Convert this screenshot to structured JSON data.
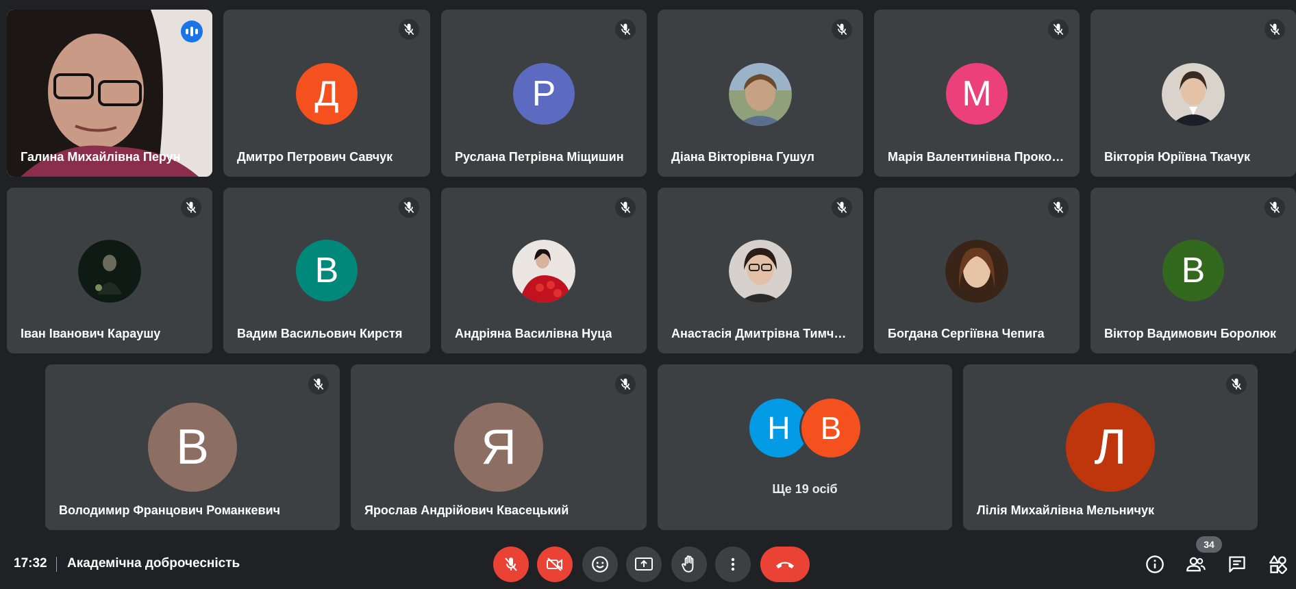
{
  "time": "17:32",
  "meeting_title": "Академічна доброчесність",
  "participant_count": "34",
  "participants": [
    {
      "name": "Галина Михайлівна Перун"
    },
    {
      "name": "Дмитро Петрович Савчук",
      "initial": "Д",
      "color": "#f4511e"
    },
    {
      "name": "Руслана Петрівна Міщишин",
      "initial": "Р",
      "color": "#5c6bc0"
    },
    {
      "name": "Діана Вікторівна Гушул"
    },
    {
      "name": "Марія Валентинівна Прокоп...",
      "initial": "М",
      "color": "#ec407a"
    },
    {
      "name": "Вікторія Юріївна Ткачук"
    },
    {
      "name": "Іван Іванович Караушу"
    },
    {
      "name": "Вадим Васильович Кирстя",
      "initial": "В",
      "color": "#00897b"
    },
    {
      "name": "Андріяна Василівна Нуца"
    },
    {
      "name": "Анастасія Дмитрівна Тимчи..."
    },
    {
      "name": "Богдана Сергіївна Чепига"
    },
    {
      "name": "Віктор Вадимович Боролюк",
      "initial": "В",
      "color": "#33691e"
    },
    {
      "name": "Володимир Францович Романкевич",
      "initial": "В",
      "color": "#8d6e63"
    },
    {
      "name": "Ярослав Андрійович Квасецький",
      "initial": "Я",
      "color": "#8d6e63"
    },
    {
      "name": "Лілія Михайлівна Мельничук",
      "initial": "Л",
      "color": "#bf360c"
    }
  ],
  "others_tile": {
    "label": "Ще 19 осіб",
    "initials": [
      {
        "initial": "Н",
        "color": "#039be5"
      },
      {
        "initial": "В",
        "color": "#f4511e"
      }
    ]
  },
  "colors": {
    "background": "#202124",
    "tile": "#3c4043",
    "active_outline": "#8ab4f8",
    "danger": "#ea4335"
  }
}
